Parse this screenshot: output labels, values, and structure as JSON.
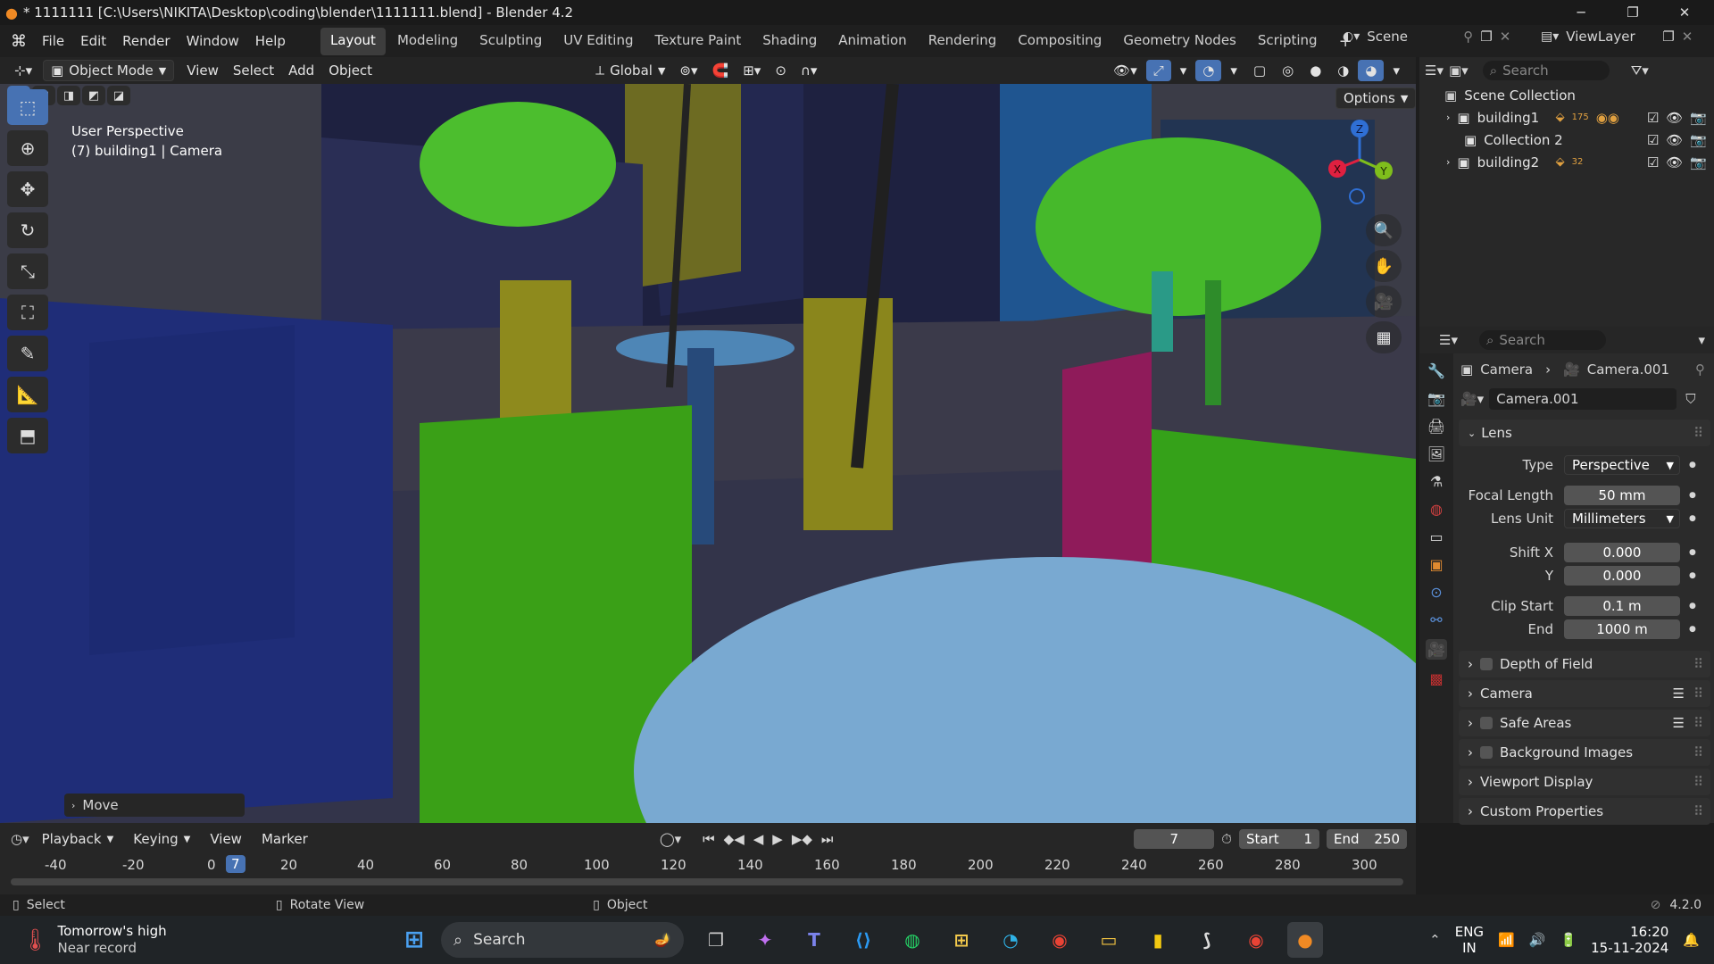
{
  "window": {
    "title": "* 1111111 [C:\\Users\\NIKITA\\Desktop\\coding\\blender\\1111111.blend] - Blender 4.2",
    "controls": [
      "─",
      "❐",
      "✕"
    ]
  },
  "menu": [
    "File",
    "Edit",
    "Render",
    "Window",
    "Help"
  ],
  "workspaces": [
    "Layout",
    "Modeling",
    "Sculpting",
    "UV Editing",
    "Texture Paint",
    "Shading",
    "Animation",
    "Rendering",
    "Compositing",
    "Geometry Nodes",
    "Scripting"
  ],
  "active_workspace": "Layout",
  "scene": {
    "name": "Scene",
    "view_layer": "ViewLayer"
  },
  "viewport_header": {
    "mode": "Object Mode",
    "menus": [
      "View",
      "Select",
      "Add",
      "Object"
    ],
    "transform_orientation": "Global",
    "options_label": "Options"
  },
  "viewport": {
    "perspective_label": "User Perspective",
    "object_label": "(7) building1 | Camera",
    "last_operator": "Move",
    "gizmo_axes": [
      "X",
      "Y",
      "Z"
    ]
  },
  "outliner": {
    "search_placeholder": "Search",
    "root": "Scene Collection",
    "items": [
      {
        "name": "building1",
        "badge": "175"
      },
      {
        "name": "Collection 2",
        "badge": ""
      },
      {
        "name": "building2",
        "badge": "32"
      }
    ]
  },
  "properties": {
    "search_placeholder": "Search",
    "breadcrumb": [
      "Camera",
      "Camera.001"
    ],
    "datablock": "Camera.001",
    "lens_panel": "Lens",
    "fields": {
      "type_label": "Type",
      "type_value": "Perspective",
      "focal_label": "Focal Length",
      "focal_value": "50 mm",
      "lens_unit_label": "Lens Unit",
      "lens_unit_value": "Millimeters",
      "shift_x_label": "Shift X",
      "shift_x_value": "0.000",
      "shift_y_label": "Y",
      "shift_y_value": "0.000",
      "clip_start_label": "Clip Start",
      "clip_start_value": "0.1 m",
      "clip_end_label": "End",
      "clip_end_value": "1000 m"
    },
    "subpanels": [
      "Depth of Field",
      "Camera",
      "Safe Areas",
      "Background Images",
      "Viewport Display",
      "Custom Properties"
    ]
  },
  "timeline": {
    "menus": [
      "Playback",
      "Keying",
      "View",
      "Marker"
    ],
    "current_frame": "7",
    "start_label": "Start",
    "start_value": "1",
    "end_label": "End",
    "end_value": "250",
    "ruler": [
      "-40",
      "-20",
      "0",
      "7",
      "20",
      "40",
      "60",
      "80",
      "100",
      "120",
      "140",
      "160",
      "180",
      "200",
      "220",
      "240",
      "260",
      "280",
      "300"
    ]
  },
  "statusbar": {
    "hints": [
      "Select",
      "Rotate View",
      "Object"
    ],
    "version": "4.2.0"
  },
  "taskbar": {
    "weather_title": "Tomorrow's high",
    "weather_sub": "Near record",
    "search_label": "Search",
    "lang": "ENG",
    "region": "IN",
    "time": "16:20",
    "date": "15-11-2024"
  }
}
